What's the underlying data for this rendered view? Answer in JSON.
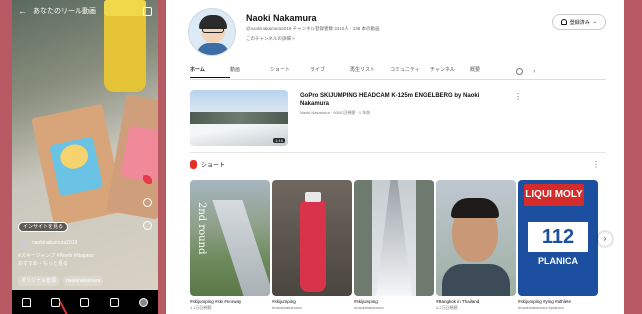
{
  "phone": {
    "header_title": "あなたのリール動画",
    "tag": "インサイトを見る",
    "username": "naokinakamura2019",
    "caption1": "#スキージャンプ #Reels #Nagano",
    "caption2": "おすすめ・もっと見る",
    "music1": "オリジナル音源",
    "music2": "naokinakamura"
  },
  "channel": {
    "name": "Naoki Nakamura",
    "meta": "@naokinakamura2019 チャンネル登録者数 3410人 · 138 本の動画",
    "more": "このチャンネルの詳細 >",
    "subscribe_label": "登録済み"
  },
  "tabs": [
    "ホーム",
    "動画",
    "ショート",
    "ライブ",
    "再生リスト",
    "コミュニティ",
    "チャンネル",
    "概要"
  ],
  "featured": {
    "title": "GoPro SKIJUMPING HEADCAM K-125m ENGELBERG by Naoki Nakamura",
    "meta": "Naoki Nakamura · 9000 回視聴 · 1 年前",
    "duration": "1:16"
  },
  "shorts_section": {
    "title": "ショート"
  },
  "shorts": [
    {
      "title": "#skijumping #ski #norway",
      "sub": "1.1万回視聴",
      "overlay": "2nd round"
    },
    {
      "title": "#skijumping",
      "sub": "#naokinakamura",
      "overlay": ""
    },
    {
      "title": "#skijumping",
      "sub": "#naokinakamura",
      "overlay": ""
    },
    {
      "title": "#Bangkok in Thailand",
      "sub": "4.2万回視聴",
      "overlay": ""
    },
    {
      "title": "#skijumping #ying #athlete",
      "sub": "#naokinakamura #planica",
      "overlay": ""
    }
  ],
  "shorts5_brand": "LIQUI MOLY",
  "shorts5_number": "112",
  "shorts5_place": "PLANICA"
}
